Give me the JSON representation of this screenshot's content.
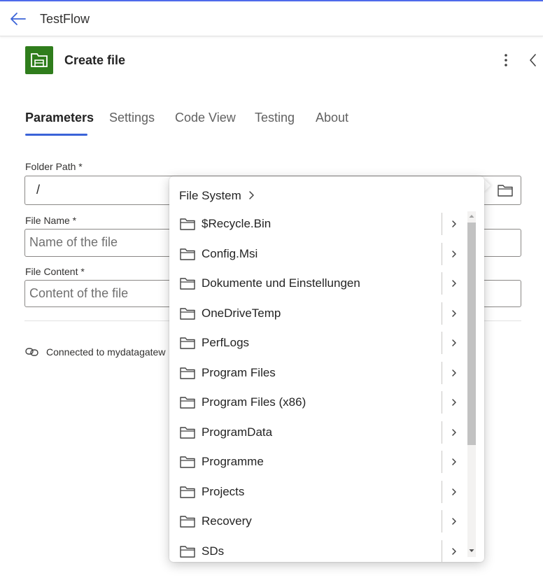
{
  "header": {
    "flow_title": "TestFlow"
  },
  "action": {
    "title": "Create file",
    "accent_color": "#2f7d1c"
  },
  "tabs": [
    {
      "label": "Parameters",
      "active": true
    },
    {
      "label": "Settings"
    },
    {
      "label": "Code View"
    },
    {
      "label": "Testing"
    },
    {
      "label": "About"
    }
  ],
  "fields": {
    "folder_path": {
      "label": "Folder Path *",
      "value": "/"
    },
    "file_name": {
      "label": "File Name *",
      "placeholder": "Name of the file"
    },
    "file_content": {
      "label": "File Content *",
      "placeholder": "Content of the file"
    }
  },
  "connection": {
    "text": "Connected to mydatagatew"
  },
  "picker": {
    "breadcrumb": "File System",
    "items": [
      {
        "label": "$Recycle.Bin"
      },
      {
        "label": "Config.Msi"
      },
      {
        "label": "Dokumente und Einstellungen"
      },
      {
        "label": "OneDriveTemp"
      },
      {
        "label": "PerfLogs"
      },
      {
        "label": "Program Files"
      },
      {
        "label": "Program Files (x86)"
      },
      {
        "label": "ProgramData"
      },
      {
        "label": "Programme"
      },
      {
        "label": "Projects"
      },
      {
        "label": "Recovery"
      },
      {
        "label": "SDs"
      }
    ]
  }
}
